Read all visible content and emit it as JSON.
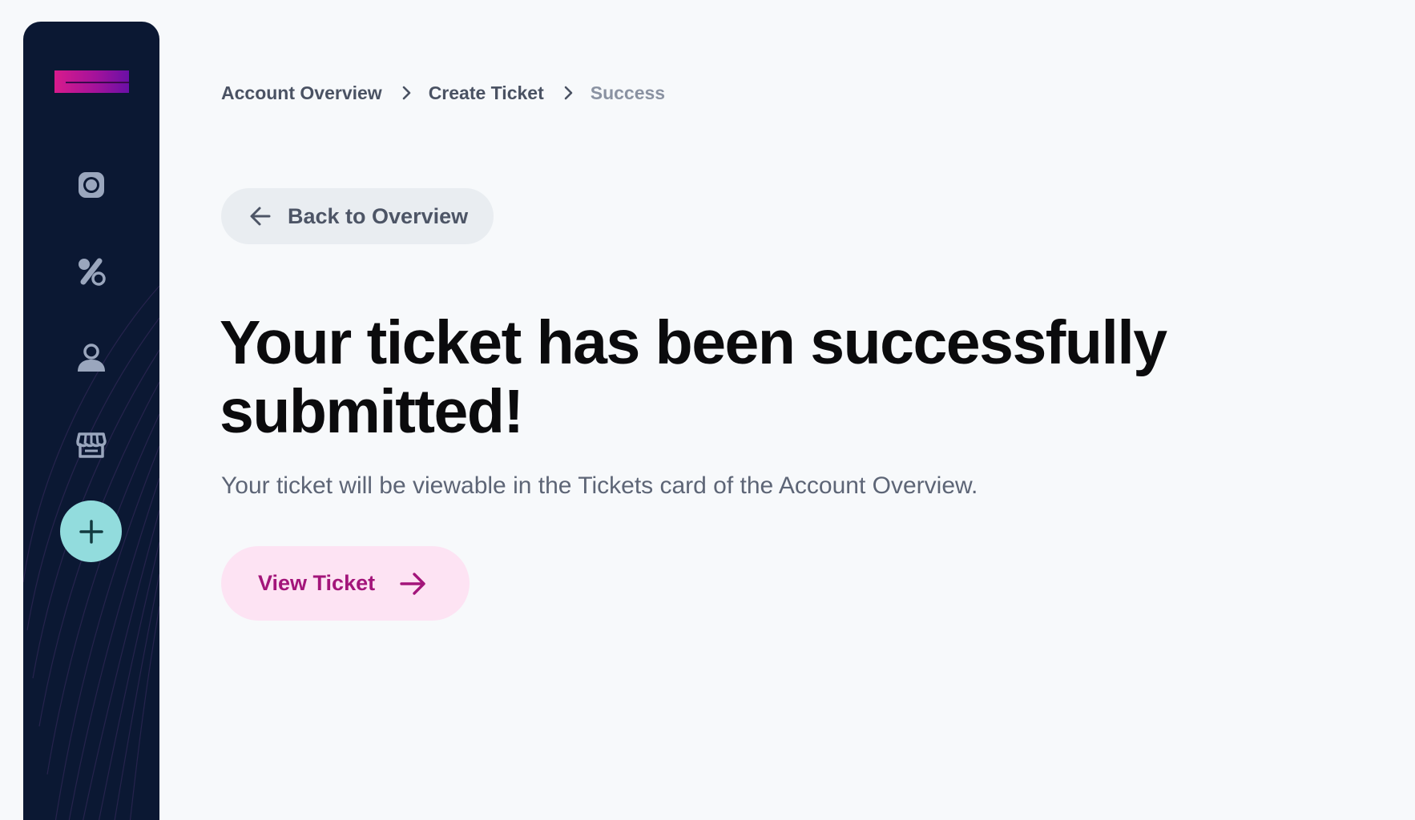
{
  "sidebar": {
    "logo": "brand-logo",
    "nav_items": [
      {
        "icon": "record-icon"
      },
      {
        "icon": "percent-icon"
      },
      {
        "icon": "user-icon"
      },
      {
        "icon": "store-icon"
      }
    ],
    "add_icon": "plus-icon",
    "colors": {
      "background": "#0b1833",
      "icon": "#9aa6bd",
      "add_button": "#92dcdd",
      "logo_start": "#d81b8c",
      "logo_end": "#6a10a6"
    }
  },
  "breadcrumb": {
    "items": [
      "Account Overview",
      "Create Ticket"
    ],
    "current": "Success"
  },
  "back_button": {
    "label": "Back to Overview",
    "icon": "arrow-left-icon"
  },
  "main": {
    "headline": "Your ticket has been successfully submitted!",
    "subtext": "Your ticket will be viewable in the Tickets card of the Account Overview."
  },
  "view_ticket_button": {
    "label": "View Ticket",
    "icon": "arrow-right-icon",
    "colors": {
      "background": "#fde3f3",
      "text": "#a3157a"
    }
  }
}
